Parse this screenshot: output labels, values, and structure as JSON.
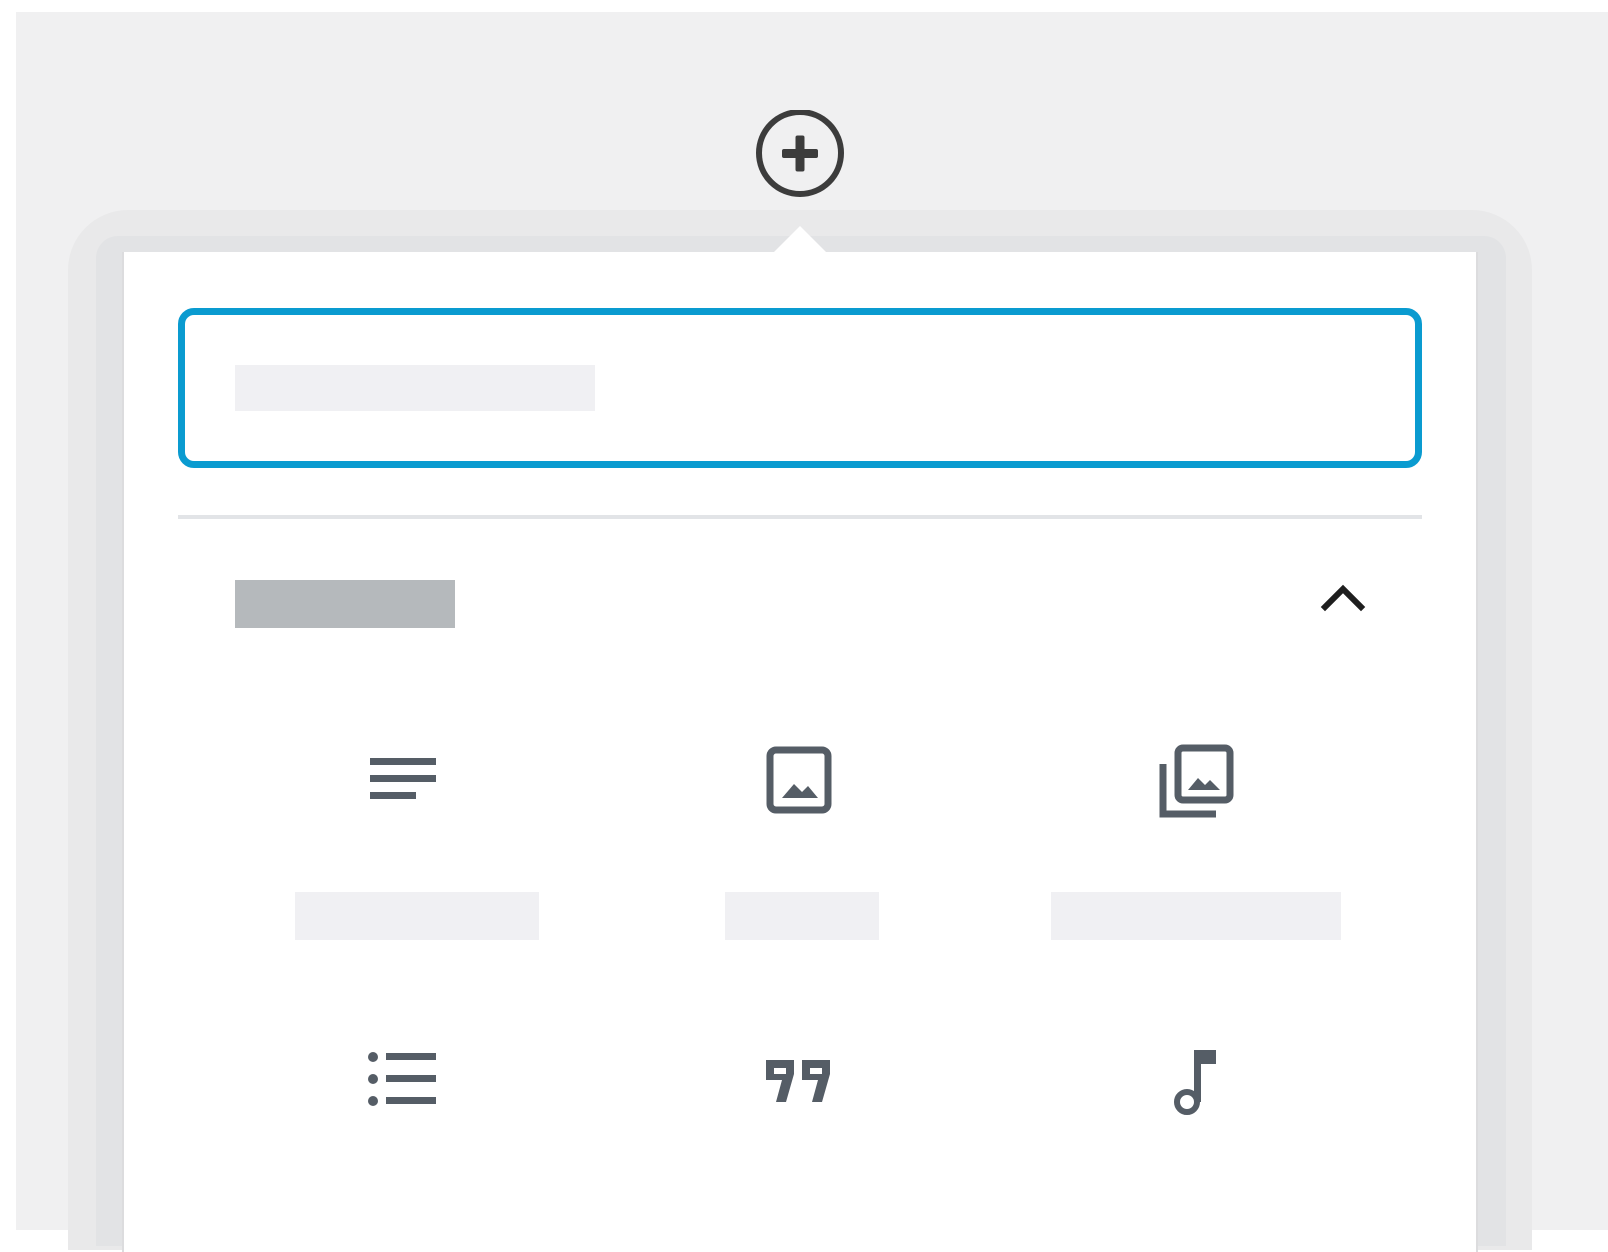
{
  "inserter": {
    "toggle_icon": "plus-circle-icon",
    "search": {
      "placeholder": "",
      "value": ""
    },
    "panel": {
      "title": "",
      "collapse_icon": "chevron-up-icon",
      "blocks": [
        {
          "icon": "paragraph-icon",
          "label": ""
        },
        {
          "icon": "image-icon",
          "label": ""
        },
        {
          "icon": "gallery-icon",
          "label": ""
        },
        {
          "icon": "list-icon",
          "label": ""
        },
        {
          "icon": "quote-icon",
          "label": ""
        },
        {
          "icon": "audio-icon",
          "label": ""
        }
      ]
    }
  },
  "colors": {
    "background": "#f0f0f1",
    "accent": "#0a9bd0",
    "icon": "#555d66",
    "dark_icon": "#1e1e1e"
  }
}
